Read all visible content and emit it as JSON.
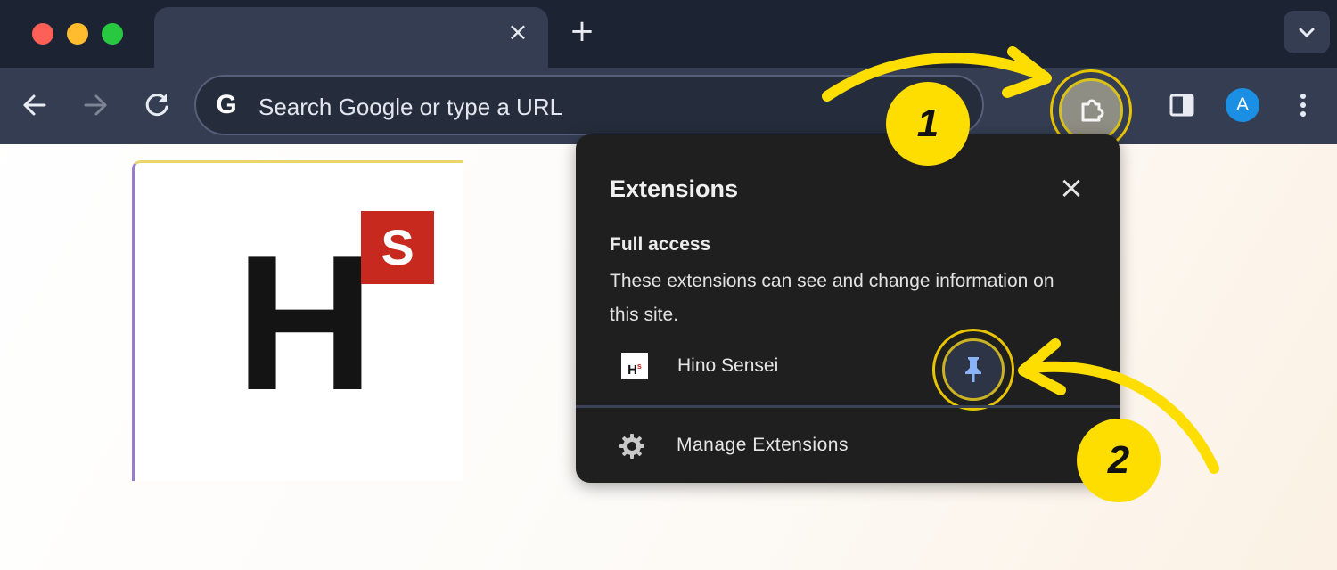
{
  "window": {
    "traffic_lights": {
      "close": "#fe5f57",
      "minimize": "#febc2e",
      "zoom": "#28c840"
    },
    "tab": {
      "close_icon": "×"
    },
    "new_tab_icon": "+",
    "tab_search_icon": "chevron-down-icon"
  },
  "toolbar": {
    "back_icon": "arrow-left-icon",
    "forward_icon": "arrow-right-icon",
    "reload_icon": "reload-icon",
    "omnibox": {
      "logo": "G",
      "placeholder": "Search Google or type a URL"
    },
    "extensions_icon": "puzzle-icon",
    "side_panel_icon": "side-panel-icon",
    "avatar_initial": "A",
    "menu_icon": "three-dots-icon"
  },
  "page": {
    "logo": {
      "letter": "H",
      "badge": "S",
      "badge_color": "#c8291f"
    }
  },
  "extensions_popup": {
    "title": "Extensions",
    "close_icon": "×",
    "section_title": "Full access",
    "section_description": "These extensions can see and change information on this site.",
    "items": [
      {
        "name": "Hino Sensei",
        "icon_letter": "H",
        "icon_badge": "s",
        "pin_icon": "pin-icon"
      }
    ],
    "manage_label": "Manage Extensions",
    "manage_icon": "gear-icon"
  },
  "annotations": {
    "step_1": "1",
    "step_2": "2",
    "color": "#fedd00"
  }
}
